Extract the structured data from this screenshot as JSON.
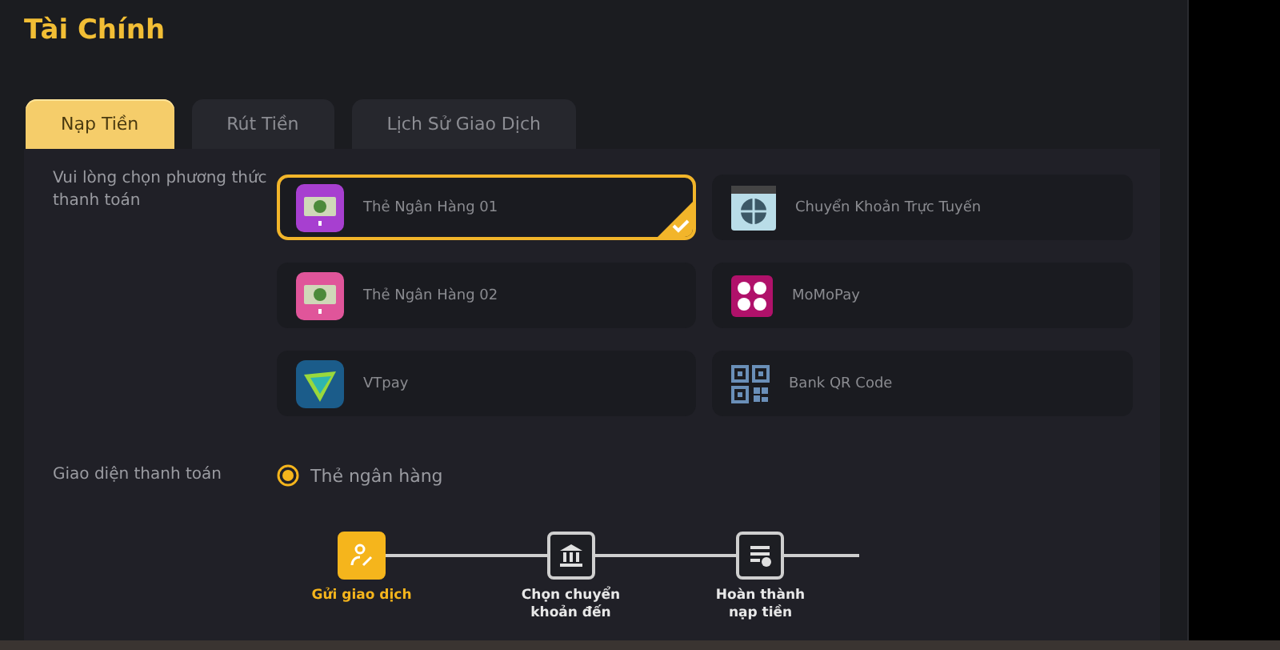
{
  "title": "Tài Chính",
  "tabs": [
    {
      "label": "Nạp Tiền",
      "selected": true
    },
    {
      "label": "Rút Tiền",
      "selected": false
    },
    {
      "label": "Lịch Sử Giao Dịch",
      "selected": false
    }
  ],
  "method_label": "Vui lòng chọn phương thức thanh toán",
  "methods": [
    {
      "label": "Thẻ Ngân Hàng 01",
      "kind": "card",
      "color": "#a73fd0",
      "selected": true
    },
    {
      "label": "Chuyển Khoản Trực Tuyến",
      "kind": "online",
      "selected": false
    },
    {
      "label": "Thẻ Ngân Hàng 02",
      "kind": "card",
      "color": "#e0559a",
      "selected": false
    },
    {
      "label": "MoMoPay",
      "kind": "momo",
      "selected": false
    },
    {
      "label": "VTpay",
      "kind": "vtpay",
      "selected": false
    },
    {
      "label": "Bank QR Code",
      "kind": "qr",
      "selected": false
    }
  ],
  "interface_label": "Giao diện thanh toán",
  "interface_options": [
    {
      "label": "Thẻ ngân hàng",
      "selected": true
    }
  ],
  "steps": [
    {
      "label": "Gửi giao dịch",
      "kind": "submit",
      "active": true
    },
    {
      "label": "Chọn chuyển khoản đến",
      "kind": "bank",
      "active": false
    },
    {
      "label": "Hoàn thành nạp tiền",
      "kind": "done",
      "active": false
    }
  ]
}
